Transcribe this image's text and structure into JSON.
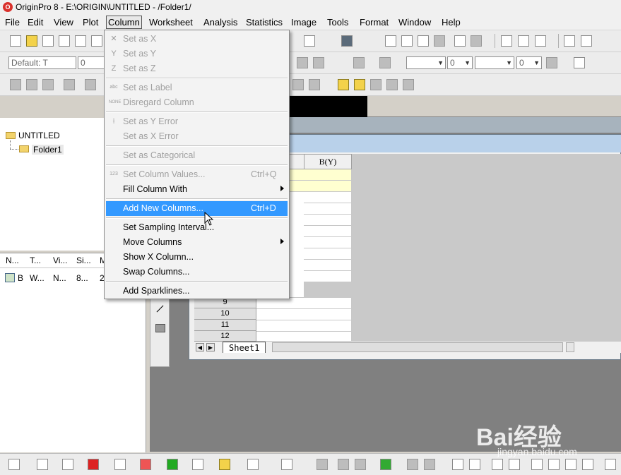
{
  "window": {
    "title": "OriginPro 8 - E:\\ORIGIN\\UNTITLED - /Folder1/",
    "app_icon": "origin-logo-icon"
  },
  "menubar": {
    "items": [
      {
        "label": "File"
      },
      {
        "label": "Edit"
      },
      {
        "label": "View"
      },
      {
        "label": "Plot"
      },
      {
        "label": "Column"
      },
      {
        "label": "Worksheet"
      },
      {
        "label": "Analysis"
      },
      {
        "label": "Statistics"
      },
      {
        "label": "Image"
      },
      {
        "label": "Tools"
      },
      {
        "label": "Format"
      },
      {
        "label": "Window"
      },
      {
        "label": "Help"
      }
    ],
    "active": "Column"
  },
  "format_toolbar": {
    "font_combo": "Default: T",
    "size_combo": "0",
    "line_width_combo": "0",
    "pattern_combo": "0"
  },
  "project_explorer": {
    "tree_root": "UNTITLED",
    "tree_child": "Folder1",
    "list_headers": [
      "N...",
      "T...",
      "Vi...",
      "Si...",
      "M"
    ],
    "list_row": [
      "B",
      "W...",
      "N...",
      "8...",
      "2"
    ]
  },
  "workbook": {
    "column_b_header": "B(Y)",
    "row_numbers": [
      "9",
      "10",
      "11",
      "12"
    ],
    "sheet_tab": "Sheet1"
  },
  "column_menu": {
    "items": [
      {
        "label": "Set as X",
        "shortcut": "",
        "enabled": false,
        "icon": "x-axis-icon"
      },
      {
        "label": "Set as Y",
        "shortcut": "",
        "enabled": false,
        "icon": "y-axis-icon"
      },
      {
        "label": "Set as Z",
        "shortcut": "",
        "enabled": false,
        "icon": "z-axis-icon"
      },
      {
        "label": "Set as Label",
        "shortcut": "",
        "enabled": false,
        "icon": "label-icon"
      },
      {
        "label": "Disregard Column",
        "shortcut": "",
        "enabled": false,
        "icon": "none-icon"
      },
      {
        "label": "Set as Y Error",
        "shortcut": "",
        "enabled": false,
        "icon": "error-bar-icon"
      },
      {
        "label": "Set as X Error",
        "shortcut": "",
        "enabled": false,
        "icon": ""
      },
      {
        "label": "Set as Categorical",
        "shortcut": "",
        "enabled": false,
        "icon": ""
      },
      {
        "label": "Set Column Values...",
        "shortcut": "Ctrl+Q",
        "enabled": false,
        "icon": "column-values-icon"
      },
      {
        "label": "Fill Column With",
        "shortcut": "",
        "enabled": true,
        "icon": "",
        "submenu": true
      },
      {
        "label": "Add New Columns...",
        "shortcut": "Ctrl+D",
        "enabled": true,
        "icon": "",
        "highlighted": true
      },
      {
        "label": "Set Sampling Interval...",
        "shortcut": "",
        "enabled": true,
        "icon": ""
      },
      {
        "label": "Move Columns",
        "shortcut": "",
        "enabled": true,
        "icon": "",
        "submenu": true
      },
      {
        "label": "Show X Column...",
        "shortcut": "",
        "enabled": true,
        "icon": ""
      },
      {
        "label": "Swap Columns...",
        "shortcut": "",
        "enabled": true,
        "icon": ""
      },
      {
        "label": "Add Sparklines...",
        "shortcut": "",
        "enabled": true,
        "icon": ""
      }
    ]
  },
  "watermark": {
    "logo": "Bai经验",
    "url": "jingyan.baidu.com"
  },
  "colors": {
    "highlight": "#3399ff",
    "yellow_cell": "#ffffd0",
    "caption": "#b9d1ea"
  }
}
